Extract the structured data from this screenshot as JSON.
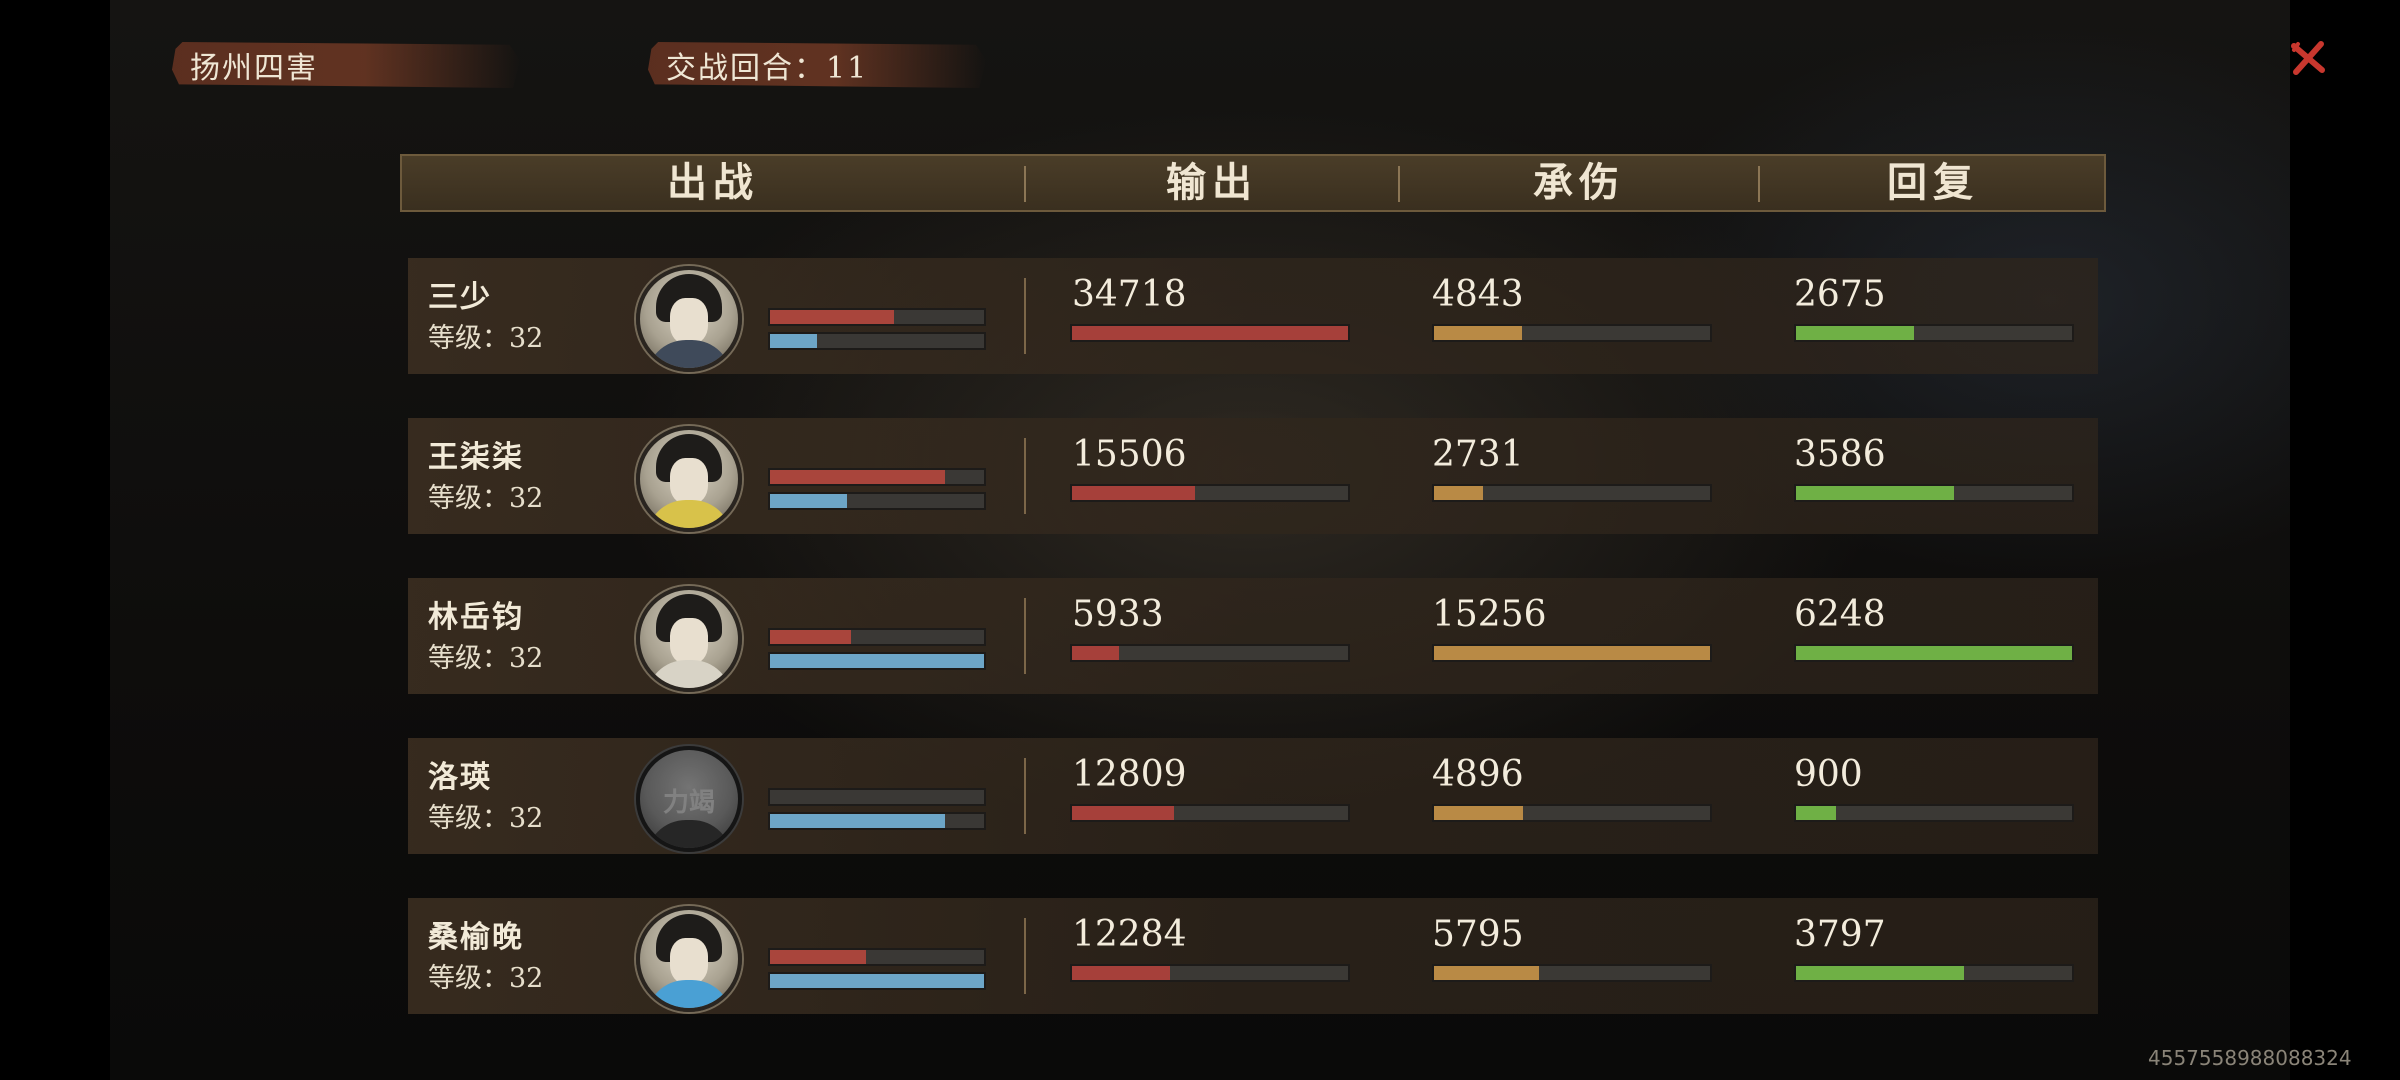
{
  "top": {
    "stage_title": "扬州四害",
    "round_text": "交战回合：11"
  },
  "header": {
    "col_units": "出战",
    "col_output": "输出",
    "col_taken": "承伤",
    "col_heal": "回复"
  },
  "colors": {
    "output": "#a6403a",
    "taken": "#b98a45",
    "heal": "#6fb045",
    "hp": "#a9453c",
    "mp": "#6da6c8"
  },
  "max": {
    "output": 34718,
    "taken": 15256,
    "heal": 6248
  },
  "rows": [
    {
      "name": "三少",
      "level": "等级：32",
      "avatar": "portrait-male-young",
      "avatar_text": "",
      "hp": 0.58,
      "mp": 0.22,
      "output": "34718",
      "taken": "4843",
      "heal": "2675"
    },
    {
      "name": "王柒柒",
      "level": "等级：32",
      "avatar": "portrait-female-flower",
      "avatar_text": "",
      "hp": 0.82,
      "mp": 0.36,
      "output": "15506",
      "taken": "2731",
      "heal": "3586"
    },
    {
      "name": "林岳钧",
      "level": "等级：32",
      "avatar": "portrait-male-dark",
      "avatar_text": "",
      "hp": 0.38,
      "mp": 1.0,
      "output": "5933",
      "taken": "15256",
      "heal": "6248"
    },
    {
      "name": "洛瑛",
      "level": "等级：32",
      "avatar": "portrait-exhausted",
      "avatar_text": "力竭",
      "hp": 0.0,
      "mp": 0.82,
      "output": "12809",
      "taken": "4896",
      "heal": "900"
    },
    {
      "name": "桑榆晚",
      "level": "等级：32",
      "avatar": "portrait-female-blue",
      "avatar_text": "",
      "hp": 0.45,
      "mp": 1.0,
      "output": "12284",
      "taken": "5795",
      "heal": "3797"
    }
  ],
  "watermark": "4557558988088324"
}
